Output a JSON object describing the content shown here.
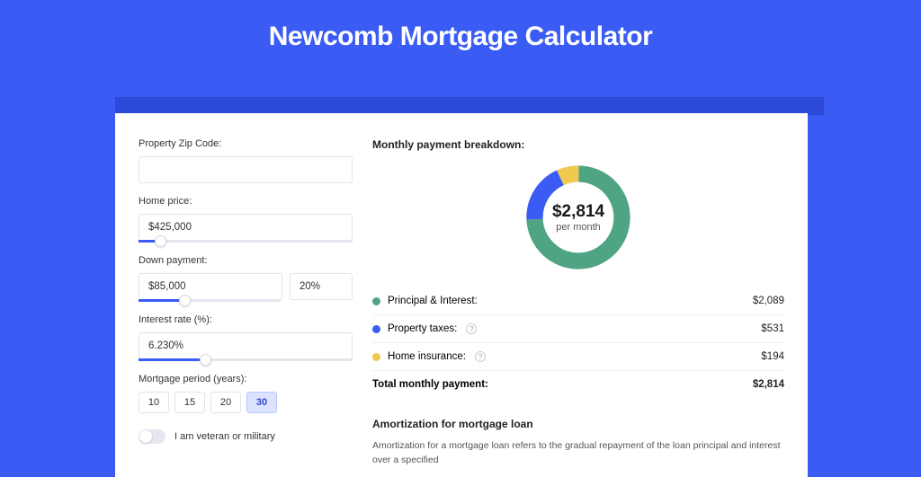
{
  "title": "Newcomb Mortgage Calculator",
  "form": {
    "zip_label": "Property Zip Code:",
    "zip_value": "",
    "home_price_label": "Home price:",
    "home_price_value": "$425,000",
    "down_payment_label": "Down payment:",
    "down_payment_amount": "$85,000",
    "down_payment_percent": "20%",
    "interest_label": "Interest rate (%):",
    "interest_value": "6.230%",
    "period_label": "Mortgage period (years):",
    "periods": [
      "10",
      "15",
      "20",
      "30"
    ],
    "period_selected": "30",
    "veteran_label": "I am veteran or military"
  },
  "breakdown": {
    "title": "Monthly payment breakdown:",
    "donut_amount": "$2,814",
    "donut_sub": "per month",
    "items": [
      {
        "label": "Principal & Interest:",
        "value": "$2,089",
        "color": "green"
      },
      {
        "label": "Property taxes:",
        "value": "$531",
        "color": "blue",
        "help": true
      },
      {
        "label": "Home insurance:",
        "value": "$194",
        "color": "yellow",
        "help": true
      }
    ],
    "total_label": "Total monthly payment:",
    "total_value": "$2,814"
  },
  "amortization": {
    "title": "Amortization for mortgage loan",
    "text": "Amortization for a mortgage loan refers to the gradual repayment of the loan principal and interest over a specified"
  },
  "chart_data": {
    "type": "pie",
    "title": "Monthly payment breakdown",
    "series": [
      {
        "name": "Principal & Interest",
        "value": 2089,
        "color": "#4fa583"
      },
      {
        "name": "Property taxes",
        "value": 531,
        "color": "#3a5cf4"
      },
      {
        "name": "Home insurance",
        "value": 194,
        "color": "#f0c94f"
      }
    ],
    "total": 2814,
    "center_label": "$2,814 per month"
  }
}
